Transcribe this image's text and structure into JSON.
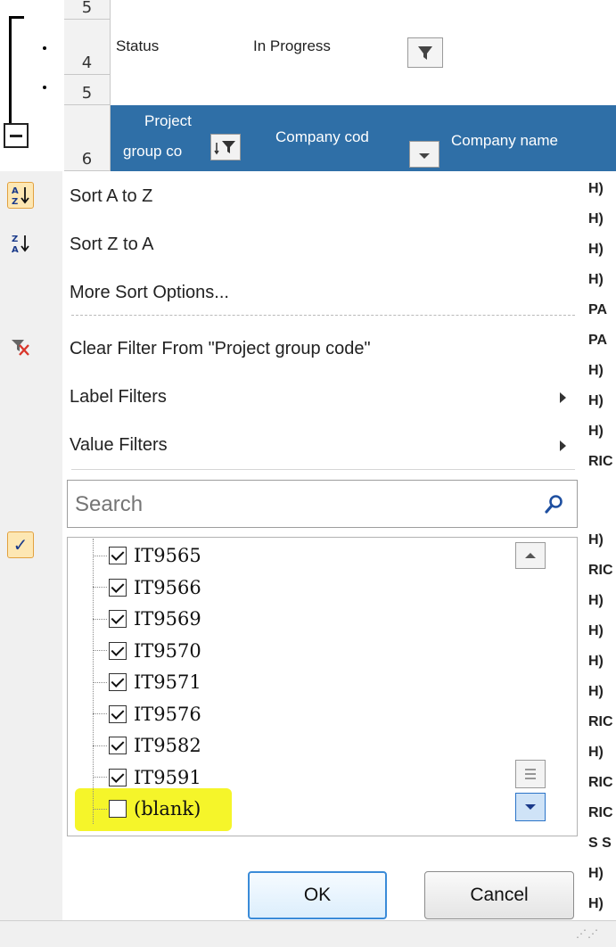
{
  "sheet": {
    "row_numbers": [
      "5",
      "4",
      "5",
      "6"
    ],
    "status_label": "Status",
    "status_value": "In Progress",
    "headers": {
      "project_group_line1": "Project",
      "project_group_line2": "group co",
      "company_code": "Company cod",
      "company_name": "Company name"
    },
    "right_column_fragments": [
      "H)",
      "H)",
      "H)",
      "H)",
      "PA",
      "PA",
      "H)",
      "H)",
      "H)",
      "RIC",
      "H)",
      "RIC",
      "H)",
      "H)",
      "H)",
      "H)",
      "RIC",
      "H)",
      "RIC",
      "RIC",
      "S S",
      "H)",
      "H)"
    ]
  },
  "menu": {
    "sort_az": "Sort A to Z",
    "sort_za": "Sort Z to A",
    "more_sort": "More Sort Options...",
    "clear_filter": "Clear Filter From \"Project group code\"",
    "label_filters": "Label Filters",
    "value_filters": "Value Filters"
  },
  "search": {
    "placeholder": "Search"
  },
  "items": [
    {
      "label": "IT9565",
      "checked": true
    },
    {
      "label": "IT9566",
      "checked": true
    },
    {
      "label": "IT9569",
      "checked": true
    },
    {
      "label": "IT9570",
      "checked": true
    },
    {
      "label": "IT9571",
      "checked": true
    },
    {
      "label": "IT9576",
      "checked": true
    },
    {
      "label": "IT9582",
      "checked": true
    },
    {
      "label": "IT9591",
      "checked": true
    },
    {
      "label": "(blank)",
      "checked": false
    }
  ],
  "buttons": {
    "ok": "OK",
    "cancel": "Cancel"
  },
  "colors": {
    "header_blue": "#2f6fa7",
    "highlight_yellow": "#f5f52a",
    "accent_orange": "#fde7b3"
  },
  "icons": {
    "sort_az": "sort-az-icon",
    "sort_za": "sort-za-icon",
    "clear_filter": "clear-filter-icon",
    "search": "search-icon",
    "check": "check-icon"
  }
}
